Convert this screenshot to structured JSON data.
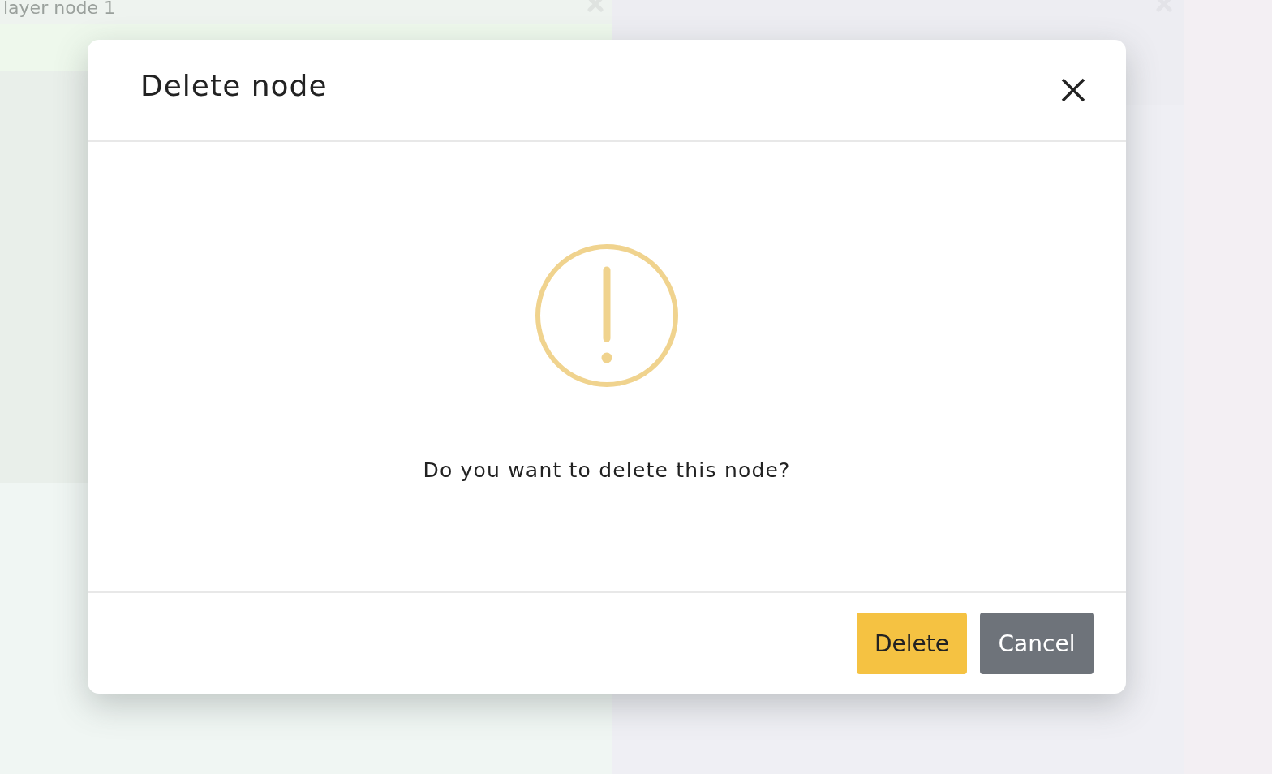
{
  "background": {
    "panel_title": "layer node 1"
  },
  "dialog": {
    "title": "Delete node",
    "message": "Do you want to delete this node?",
    "buttons": [
      {
        "label": "Delete",
        "kind": "primary"
      },
      {
        "label": "Cancel",
        "kind": "secondary"
      }
    ]
  }
}
